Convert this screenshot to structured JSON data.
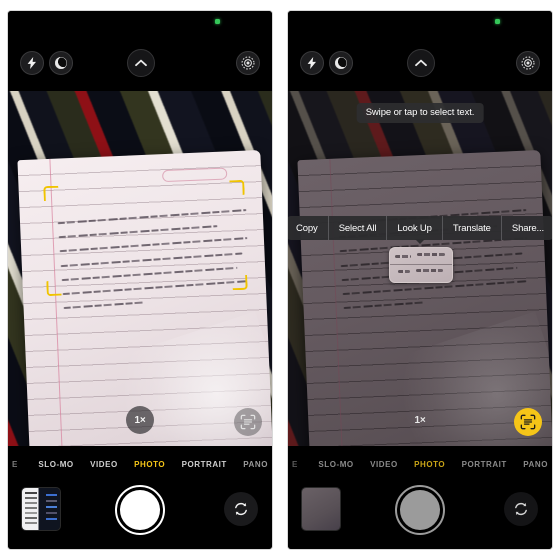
{
  "scene": {
    "description": "Two side-by-side iPhone camera screenshots demonstrating iOS Live Text",
    "accent_yellow": "#f5c518",
    "bracket_yellow": "#f0c400",
    "recording_green": "#35c759"
  },
  "left_phone": {
    "status": {
      "camera_indicator": "green-dot"
    },
    "top_controls": [
      {
        "name": "flash-toggle",
        "icon": "flash-icon",
        "state": "auto"
      },
      {
        "name": "night-mode-toggle",
        "icon": "moon-icon",
        "state": "off"
      },
      {
        "name": "expand-controls",
        "icon": "chevron-up-icon",
        "state": "collapsed"
      },
      {
        "name": "live-photo-toggle",
        "icon": "live-photo-icon",
        "state": "on"
      }
    ],
    "viewfinder": {
      "subject": "handwritten notebook page on striped fabric",
      "detected_text_region": "yellow corner brackets",
      "handwriting_lines": [
        "Live Text is a pretty cool",
        "iOS feature. It lets you",
        "recognize text from images and",
        "copy, translate with ease. You",
        "don't even need to open any",
        "other app. It works quite",
        "effectively."
      ]
    },
    "zoom_button": {
      "label": "1×"
    },
    "live_text_button": {
      "icon": "live-text-scan-icon",
      "state": "inactive"
    },
    "modes": [
      {
        "label": "E",
        "active": false,
        "clipped": "left"
      },
      {
        "label": "SLO-MO",
        "active": false
      },
      {
        "label": "VIDEO",
        "active": false
      },
      {
        "label": "PHOTO",
        "active": true
      },
      {
        "label": "PORTRAIT",
        "active": false
      },
      {
        "label": "PANO",
        "active": false,
        "clipped": "right"
      }
    ],
    "shutter": {
      "name": "shutter-button",
      "state": "enabled"
    },
    "thumbnail": {
      "name": "photo-library-thumbnail",
      "content": "screenshot preview"
    },
    "flip_camera": {
      "icon": "camera-flip-icon"
    }
  },
  "right_phone": {
    "status": {
      "camera_indicator": "green-dot"
    },
    "top_controls": [
      {
        "name": "flash-toggle",
        "icon": "flash-icon",
        "state": "auto"
      },
      {
        "name": "night-mode-toggle",
        "icon": "moon-icon",
        "state": "off"
      },
      {
        "name": "expand-controls",
        "icon": "chevron-up-icon",
        "state": "collapsed"
      },
      {
        "name": "live-photo-toggle",
        "icon": "live-photo-icon",
        "state": "on"
      }
    ],
    "tooltip": {
      "text": "Swipe or tap to select text."
    },
    "context_menu": {
      "items": [
        {
          "label": "Copy"
        },
        {
          "label": "Select All"
        },
        {
          "label": "Look Up"
        },
        {
          "label": "Translate"
        },
        {
          "label": "Share..."
        }
      ]
    },
    "magnifier": {
      "name": "text-selection-loupe",
      "sample_text": "e Tex / is fea"
    },
    "viewfinder": {
      "subject": "dimmed handwritten notebook page",
      "handwriting_lines": [
        "Live Text is a pretty cool",
        "iOS feature. It lets you",
        "recognize text from images and",
        "copy, translate with ease. You",
        "don't even need to open any",
        "other app. It works quite",
        "effectively."
      ]
    },
    "zoom_button": {
      "label": "1×"
    },
    "live_text_button": {
      "icon": "live-text-scan-icon",
      "state": "active"
    },
    "modes": [
      {
        "label": "E",
        "active": false,
        "clipped": "left"
      },
      {
        "label": "SLO-MO",
        "active": false
      },
      {
        "label": "VIDEO",
        "active": false
      },
      {
        "label": "PHOTO",
        "active": true
      },
      {
        "label": "PORTRAIT",
        "active": false
      },
      {
        "label": "PANO",
        "active": false,
        "clipped": "right"
      }
    ],
    "shutter": {
      "name": "shutter-button",
      "state": "dimmed"
    },
    "thumbnail": {
      "name": "photo-library-thumbnail",
      "content": "dimmed preview"
    },
    "flip_camera": {
      "icon": "camera-flip-icon"
    }
  }
}
